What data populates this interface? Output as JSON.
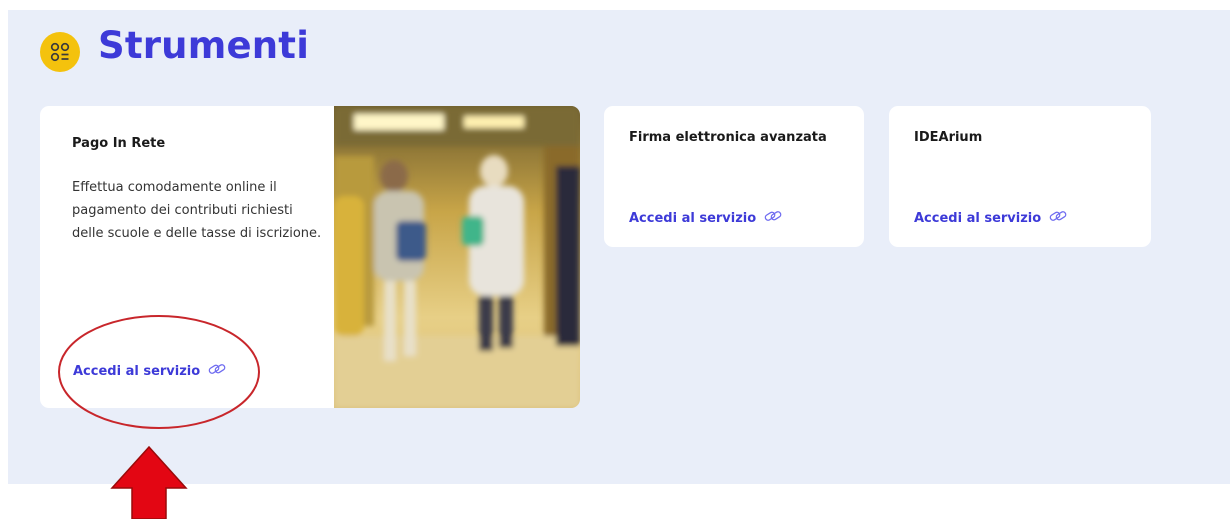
{
  "section": {
    "title": "Strumenti",
    "icon": "grid-apps-icon",
    "icon_color": "#f4c20d",
    "accent_color": "#3d3ad8"
  },
  "cards": [
    {
      "title": "Pago In Rete",
      "description": "Effettua comodamente online il pagamento dei contributi richiesti delle scuole e delle tasse di iscrizione.",
      "link_label": "Accedi al servizio",
      "link_icon": "link-icon",
      "image": "people-walking-corridor-photo"
    },
    {
      "title": "Firma elettronica avanzata",
      "link_label": "Accedi al servizio",
      "link_icon": "link-icon"
    },
    {
      "title": "IDEArium",
      "link_label": "Accedi al servizio",
      "link_icon": "link-icon"
    }
  ],
  "annotation": {
    "ellipse_color": "#c8262b",
    "arrow_color": "#e30613"
  }
}
